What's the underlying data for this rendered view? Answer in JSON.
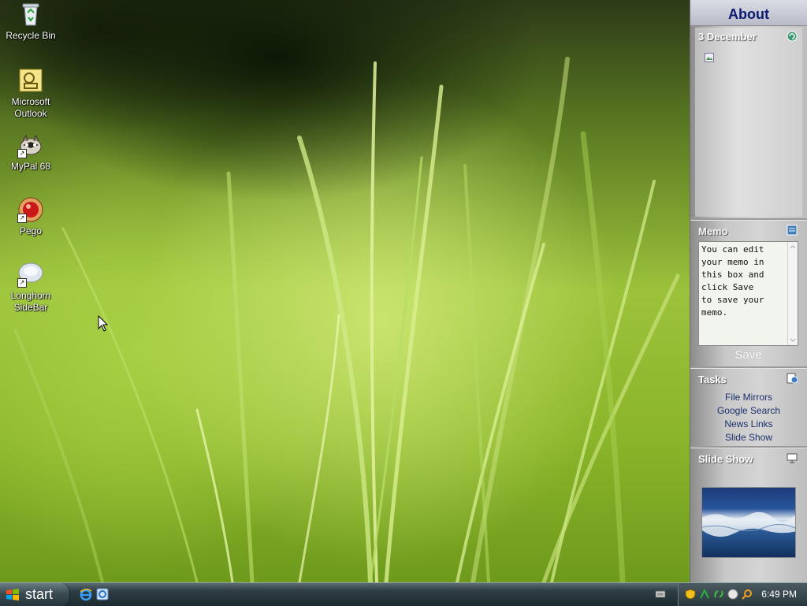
{
  "desktop": {
    "icons": [
      {
        "label": "Recycle Bin",
        "icon": "recycle-bin-icon",
        "shortcut": false
      },
      {
        "label": "Microsoft Outlook",
        "line1": "Microsoft",
        "line2": "Outlook",
        "icon": "outlook-icon",
        "shortcut": false
      },
      {
        "label": "MyPal 68",
        "icon": "mypal-icon",
        "shortcut": true
      },
      {
        "label": "Pego",
        "icon": "pego-icon",
        "shortcut": true
      },
      {
        "label": "Longhorn SideBar",
        "line1": "Longhorn",
        "line2": "SideBar",
        "icon": "longhorn-sidebar-icon",
        "shortcut": true
      }
    ]
  },
  "sidebar": {
    "title": "About",
    "calendar": {
      "date": "3 December",
      "icon": "calendar-refresh-icon"
    },
    "memo": {
      "heading": "Memo",
      "text": "You can edit\nyour memo in\nthis box and\nclick Save\nto save your\nmemo.",
      "save_label": "Save",
      "icon": "memo-icon"
    },
    "tasks": {
      "heading": "Tasks",
      "icon": "tasks-icon",
      "items": [
        "File Mirrors",
        "Google Search",
        "News Links",
        "Slide Show"
      ]
    },
    "slideshow": {
      "heading": "Slide Show",
      "icon": "slideshow-icon"
    }
  },
  "taskbar": {
    "start_label": "start",
    "quick_launch": [
      "internet-explorer-icon",
      "ie-alt-icon"
    ],
    "tray_icons": [
      "keyboard-icon",
      "shield-icon",
      "network-icon",
      "sync-icon",
      "globe-icon",
      "search-icon"
    ],
    "clock": "6:49 PM"
  },
  "colors": {
    "sidebar_title": "#0a1a6e",
    "task_link": "#1c2f6b",
    "taskbar": "#2d3d43"
  }
}
